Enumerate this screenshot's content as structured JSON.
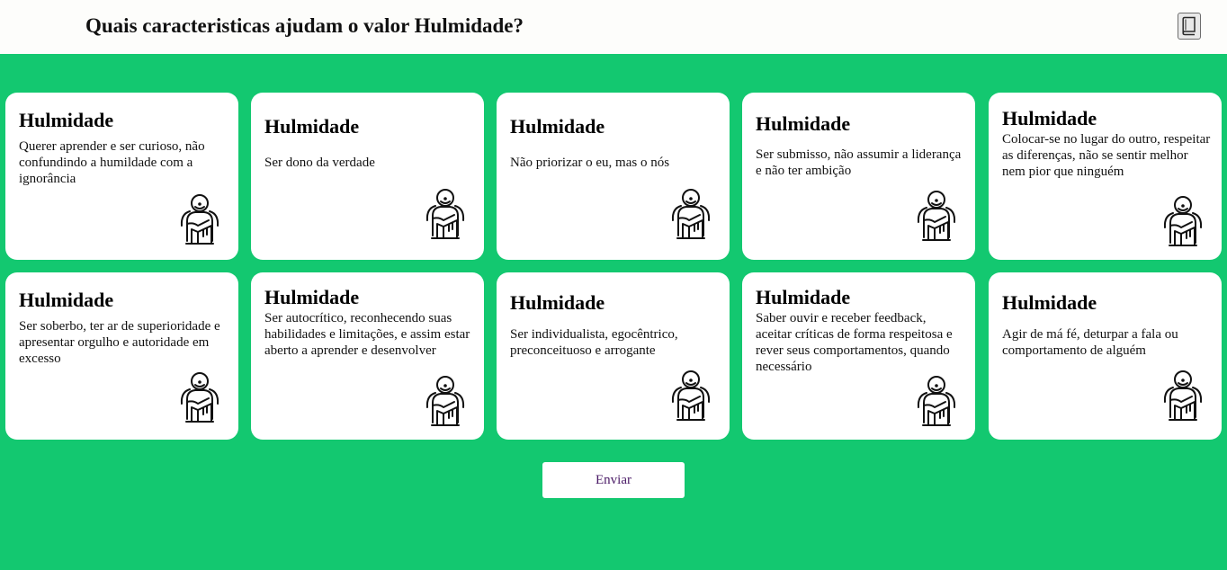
{
  "header": {
    "title": "Quais caracteristicas ajudam o valor Hulmidade?",
    "book_icon": "book-icon"
  },
  "cards": [
    {
      "title": "Hulmidade",
      "description": "Querer aprender e ser curioso, não confundindo a humildade com a ignorância",
      "icon": "humble-person-icon"
    },
    {
      "title": "Hulmidade",
      "description": "Ser dono da verdade",
      "icon": "humble-person-icon"
    },
    {
      "title": "Hulmidade",
      "description": "Não priorizar o eu, mas o nós",
      "icon": "humble-person-icon"
    },
    {
      "title": "Hulmidade",
      "description": "Ser submisso, não assumir a liderança e não ter ambição",
      "icon": "humble-person-icon"
    },
    {
      "title": "Hulmidade",
      "description": "Colocar-se no lugar do outro, respeitar as diferenças, não se sentir melhor nem pior que ninguém",
      "icon": "humble-person-icon"
    },
    {
      "title": "Hulmidade",
      "description": "Ser soberbo, ter ar de superioridade e apresentar orgulho e autoridade em excesso",
      "icon": "humble-person-icon"
    },
    {
      "title": "Hulmidade",
      "description": "Ser autocrítico, reconhecendo suas habilidades e limitações, e assim estar aberto a aprender e desenvolver",
      "icon": "humble-person-icon"
    },
    {
      "title": "Hulmidade",
      "description": "Ser individualista, egocêntrico, preconceituoso e arrogante",
      "icon": "humble-person-icon"
    },
    {
      "title": "Hulmidade",
      "description": "Saber ouvir e receber feedback, aceitar críticas de forma respeitosa e rever seus comportamentos, quando necessário",
      "icon": "humble-person-icon"
    },
    {
      "title": "Hulmidade",
      "description": "Agir de má fé, deturpar a fala ou comportamento de alguém",
      "icon": "humble-person-icon"
    }
  ],
  "submit_label": "Enviar",
  "colors": {
    "background": "#13c870",
    "header": "#fdfdfb",
    "card": "#ffffff",
    "submit_text": "#4a1a66"
  }
}
